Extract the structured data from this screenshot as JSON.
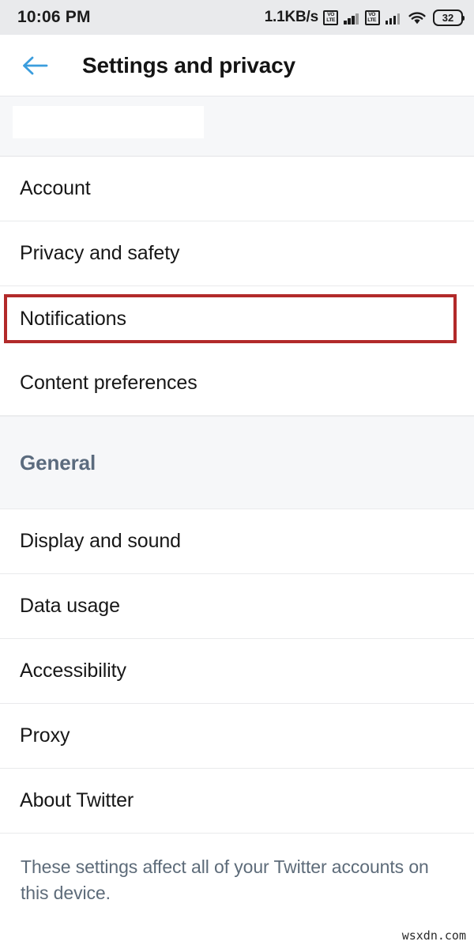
{
  "status_bar": {
    "time": "10:06 PM",
    "network_speed": "1.1KB/s",
    "volte_label_top": "VO",
    "volte_label_bottom": "LTE",
    "battery_level": "32",
    "icons": [
      "volte-icon",
      "signal-bars-icon",
      "volte-icon",
      "signal-bars-icon",
      "wifi-icon",
      "battery-icon"
    ],
    "background_color": "#e9eaec"
  },
  "app_bar": {
    "back_icon": "back-arrow-icon",
    "back_icon_color": "#3b9ddd",
    "title": "Settings and privacy"
  },
  "account_block": {
    "redacted": true
  },
  "account_section": {
    "items": [
      {
        "label": "Account",
        "highlighted": false
      },
      {
        "label": "Privacy and safety",
        "highlighted": false
      },
      {
        "label": "Notifications",
        "highlighted": true
      },
      {
        "label": "Content preferences",
        "highlighted": false
      }
    ]
  },
  "general_section": {
    "header": "General",
    "header_color": "#5b6b7e",
    "items": [
      {
        "label": "Display and sound"
      },
      {
        "label": "Data usage"
      },
      {
        "label": "Accessibility"
      },
      {
        "label": "Proxy"
      },
      {
        "label": "About Twitter"
      }
    ]
  },
  "footer": {
    "note": "These settings affect all of your Twitter accounts on this device."
  },
  "annotation": {
    "target": "Notifications",
    "color": "#b22a2a"
  },
  "watermark": {
    "text": "wsxdn.com"
  }
}
